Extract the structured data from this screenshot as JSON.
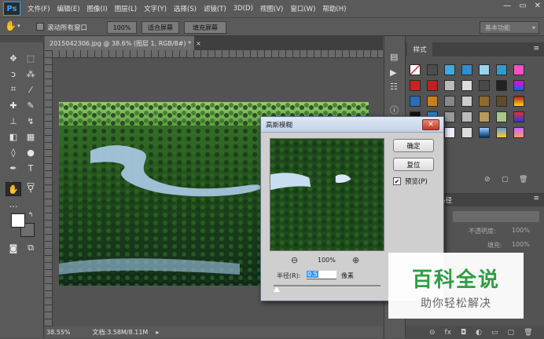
{
  "app": {
    "logo": "Ps"
  },
  "menu": [
    "文件(F)",
    "编辑(E)",
    "图像(I)",
    "图层(L)",
    "文字(Y)",
    "选择(S)",
    "滤镜(T)",
    "3D(D)",
    "视图(V)",
    "窗口(W)",
    "帮助(H)"
  ],
  "window_controls": {
    "minimize": "—",
    "restore": "▭",
    "close": "✕"
  },
  "options_bar": {
    "scroll_all_windows": "滚动所有窗口",
    "zoom_100": "100%",
    "fit_screen": "适合屏幕",
    "fill_screen": "填充屏幕",
    "workspace": "基本功能"
  },
  "document": {
    "tab_title": "2015042306.jpg @ 38.6% (图层 1, RGB/8#) *",
    "tab_close": "×",
    "status_zoom": "38.55%",
    "status_doc": "文档:3.58M/8.11M"
  },
  "styles_panel": {
    "tab_label": "样式"
  },
  "layers_panel": {
    "paths_tab": "路径",
    "opacity_label": "不透明度:",
    "opacity_value": "100%",
    "fill_label": "填充:",
    "fill_value": "100%"
  },
  "dialog": {
    "title": "高斯模糊",
    "close": "✕",
    "ok_label": "确定",
    "reset_label": "复位",
    "preview_label": "预览(P)",
    "preview_checked": true,
    "zoom_level": "100%",
    "radius_label": "半径(R):",
    "radius_value": "0.5",
    "radius_unit": "像素"
  },
  "watermark": {
    "title": "百科全说",
    "subtitle": "助你轻松解决"
  },
  "colors": {
    "accent": "#31a8ff",
    "ui_bg": "#535353",
    "dialog_bg": "#cfcfcf",
    "watermark_green": "#2e9d44"
  }
}
